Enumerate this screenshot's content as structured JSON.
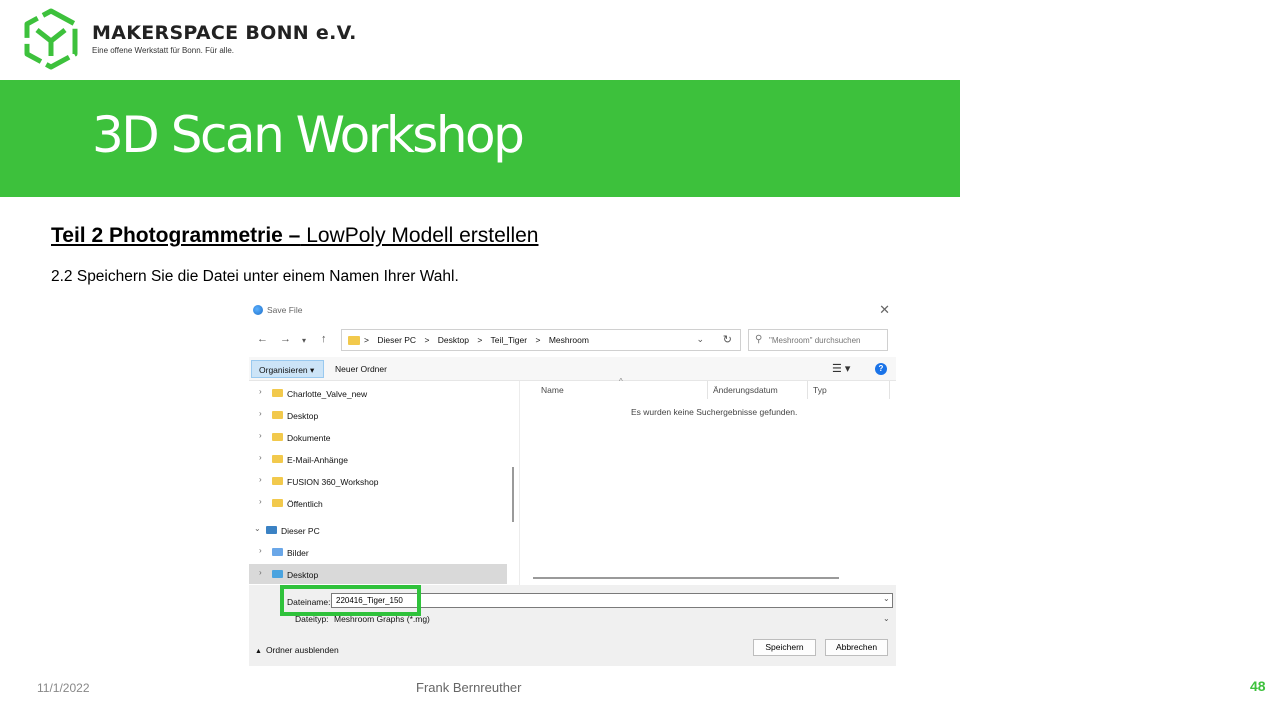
{
  "header": {
    "org_name": "MAKERSPACE BONN e.V.",
    "org_tagline": "Eine offene Werkstatt für Bonn. Für alle.",
    "brand_color": "#3dc13c",
    "title": "3D Scan Workshop"
  },
  "content": {
    "subtitle_bold": "Teil 2  Photogrammetrie  –",
    "subtitle_rest": " LowPoly Modell erstellen",
    "step": "2.2 Speichern Sie die Datei unter einem Namen Ihrer Wahl."
  },
  "dialog": {
    "title": "Save File",
    "close_icon": "close-icon",
    "address_path": [
      "Dieser PC",
      ">",
      "Desktop",
      ">",
      "Teil_Tiger",
      ">",
      "Meshroom"
    ],
    "search_placeholder": "\"Meshroom\" durchsuchen",
    "toolbar": {
      "organize": "Organisieren ▾",
      "new_folder": "Neuer Ordner"
    },
    "tree": [
      {
        "label": "Charlotte_Valve_new",
        "icon": "folder-icon"
      },
      {
        "label": "Desktop",
        "icon": "folder-icon"
      },
      {
        "label": "Dokumente",
        "icon": "folder-icon"
      },
      {
        "label": "E-Mail-Anhänge",
        "icon": "folder-icon"
      },
      {
        "label": "FUSION 360_Workshop",
        "icon": "folder-icon"
      },
      {
        "label": "Öffentlich",
        "icon": "folder-icon"
      },
      {
        "label": "Dieser PC",
        "icon": "pc-icon"
      },
      {
        "label": "Bilder",
        "icon": "pictures-icon"
      },
      {
        "label": "Desktop",
        "icon": "desktop-icon"
      }
    ],
    "columns": [
      "Name",
      "Änderungsdatum",
      "Typ"
    ],
    "empty_message": "Es wurden keine Suchergebnisse gefunden.",
    "filename_label": "Dateiname:",
    "filename_value": "220416_Tiger_150",
    "filetype_label": "Dateityp:",
    "filetype_value": "Meshroom Graphs (*.mg)",
    "hide_folders": "Ordner ausblenden",
    "save_button": "Speichern",
    "cancel_button": "Abbrechen"
  },
  "footer": {
    "date": "11/1/2022",
    "author": "Frank Bernreuther",
    "page": "48"
  }
}
